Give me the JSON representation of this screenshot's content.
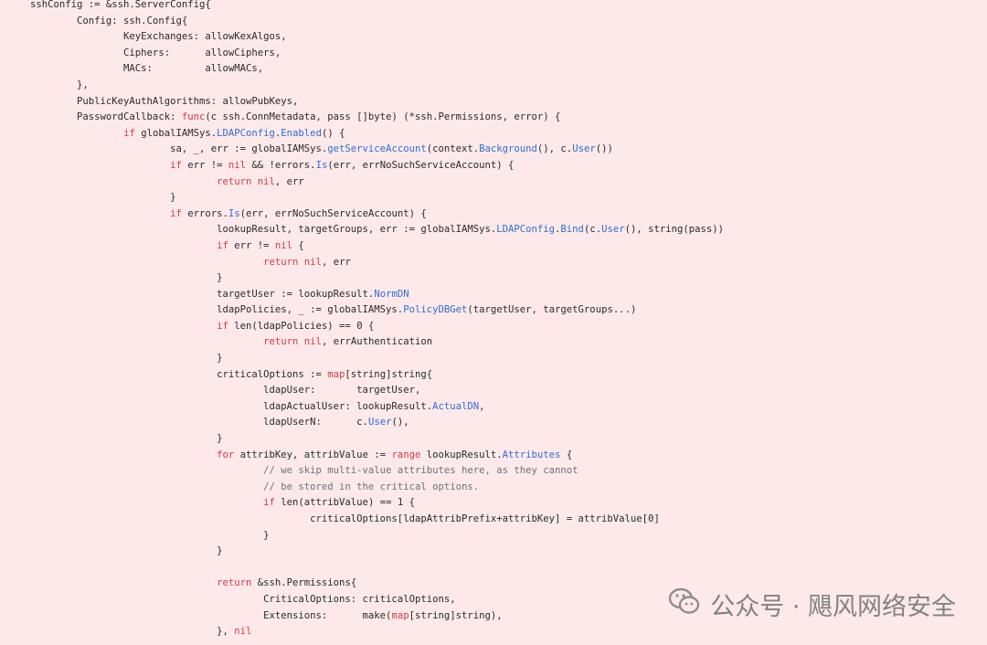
{
  "code": {
    "lines": [
      [
        [
          "sshConfig := &ssh.ServerConfig{",
          ""
        ]
      ],
      [
        [
          "\tConfig: ssh.Config{",
          ""
        ]
      ],
      [
        [
          "\t\tKeyExchanges: allowKexAlgos,",
          ""
        ]
      ],
      [
        [
          "\t\tCiphers:      allowCiphers,",
          ""
        ]
      ],
      [
        [
          "\t\tMACs:         allowMACs,",
          ""
        ]
      ],
      [
        [
          "\t},",
          ""
        ]
      ],
      [
        [
          "\tPublicKeyAuthAlgorithms: allowPubKeys,",
          ""
        ]
      ],
      [
        [
          "\tPasswordCallback: ",
          ""
        ],
        [
          "func",
          "kw"
        ],
        [
          "(c ssh.ConnMetadata, pass []byte) (*ssh.Permissions, error) {",
          ""
        ]
      ],
      [
        [
          "\t\t",
          ""
        ],
        [
          "if",
          "kw"
        ],
        [
          " globalIAMSys.",
          ""
        ],
        [
          "LDAPConfig",
          "fn"
        ],
        [
          ".",
          ""
        ],
        [
          "Enabled",
          "fn"
        ],
        [
          "() {",
          ""
        ]
      ],
      [
        [
          "\t\t\tsa, _, err := globalIAMSys.",
          ""
        ],
        [
          "getServiceAccount",
          "fn"
        ],
        [
          "(context.",
          ""
        ],
        [
          "Background",
          "fn"
        ],
        [
          "(), c.",
          ""
        ],
        [
          "User",
          "fn"
        ],
        [
          "())",
          ""
        ]
      ],
      [
        [
          "\t\t\t",
          ""
        ],
        [
          "if",
          "kw"
        ],
        [
          " err != ",
          ""
        ],
        [
          "nil",
          "kw"
        ],
        [
          " && !errors.",
          ""
        ],
        [
          "Is",
          "fn"
        ],
        [
          "(err, errNoSuchServiceAccount) {",
          ""
        ]
      ],
      [
        [
          "\t\t\t\t",
          ""
        ],
        [
          "return",
          "kw"
        ],
        [
          " ",
          ""
        ],
        [
          "nil",
          "kw"
        ],
        [
          ", err",
          ""
        ]
      ],
      [
        [
          "\t\t\t}",
          ""
        ]
      ],
      [
        [
          "\t\t\t",
          ""
        ],
        [
          "if",
          "kw"
        ],
        [
          " errors.",
          ""
        ],
        [
          "Is",
          "fn"
        ],
        [
          "(err, errNoSuchServiceAccount) {",
          ""
        ]
      ],
      [
        [
          "\t\t\t\tlookupResult, targetGroups, err := globalIAMSys.",
          ""
        ],
        [
          "LDAPConfig",
          "fn"
        ],
        [
          ".",
          ""
        ],
        [
          "Bind",
          "fn"
        ],
        [
          "(c.",
          ""
        ],
        [
          "User",
          "fn"
        ],
        [
          "(), string(pass))",
          ""
        ]
      ],
      [
        [
          "\t\t\t\t",
          ""
        ],
        [
          "if",
          "kw"
        ],
        [
          " err != ",
          ""
        ],
        [
          "nil",
          "kw"
        ],
        [
          " {",
          ""
        ]
      ],
      [
        [
          "\t\t\t\t\t",
          ""
        ],
        [
          "return",
          "kw"
        ],
        [
          " ",
          ""
        ],
        [
          "nil",
          "kw"
        ],
        [
          ", err",
          ""
        ]
      ],
      [
        [
          "\t\t\t\t}",
          ""
        ]
      ],
      [
        [
          "\t\t\t\ttargetUser := lookupResult.",
          ""
        ],
        [
          "NormDN",
          "fn"
        ]
      ],
      [
        [
          "\t\t\t\tldapPolicies, _ := globalIAMSys.",
          ""
        ],
        [
          "PolicyDBGet",
          "fn"
        ],
        [
          "(targetUser, targetGroups...)",
          ""
        ]
      ],
      [
        [
          "\t\t\t\t",
          ""
        ],
        [
          "if",
          "kw"
        ],
        [
          " len(ldapPolicies) == 0 {",
          ""
        ]
      ],
      [
        [
          "\t\t\t\t\t",
          ""
        ],
        [
          "return",
          "kw"
        ],
        [
          " ",
          ""
        ],
        [
          "nil",
          "kw"
        ],
        [
          ", errAuthentication",
          ""
        ]
      ],
      [
        [
          "\t\t\t\t}",
          ""
        ]
      ],
      [
        [
          "\t\t\t\tcriticalOptions := ",
          ""
        ],
        [
          "map",
          "kw"
        ],
        [
          "[string]string{",
          ""
        ]
      ],
      [
        [
          "\t\t\t\t\tldapUser:       targetUser,",
          ""
        ]
      ],
      [
        [
          "\t\t\t\t\tldapActualUser: lookupResult.",
          ""
        ],
        [
          "ActualDN",
          "fn"
        ],
        [
          ",",
          ""
        ]
      ],
      [
        [
          "\t\t\t\t\tldapUserN:      c.",
          ""
        ],
        [
          "User",
          "fn"
        ],
        [
          "(),",
          ""
        ]
      ],
      [
        [
          "\t\t\t\t}",
          ""
        ]
      ],
      [
        [
          "\t\t\t\t",
          ""
        ],
        [
          "for",
          "kw"
        ],
        [
          " attribKey, attribValue := ",
          ""
        ],
        [
          "range",
          "kw"
        ],
        [
          " lookupResult.",
          ""
        ],
        [
          "Attributes",
          "fn"
        ],
        [
          " {",
          ""
        ]
      ],
      [
        [
          "\t\t\t\t\t",
          ""
        ],
        [
          "// we skip multi-value attributes here, as they cannot",
          "cm"
        ]
      ],
      [
        [
          "\t\t\t\t\t",
          ""
        ],
        [
          "// be stored in the critical options.",
          "cm"
        ]
      ],
      [
        [
          "\t\t\t\t\t",
          ""
        ],
        [
          "if",
          "kw"
        ],
        [
          " len(attribValue) == 1 {",
          ""
        ]
      ],
      [
        [
          "\t\t\t\t\t\tcriticalOptions[ldapAttribPrefix+attribKey] = attribValue[0]",
          ""
        ]
      ],
      [
        [
          "\t\t\t\t\t}",
          ""
        ]
      ],
      [
        [
          "\t\t\t\t}",
          ""
        ]
      ],
      [
        [
          "",
          ""
        ]
      ],
      [
        [
          "\t\t\t\t",
          ""
        ],
        [
          "return",
          "kw"
        ],
        [
          " &ssh.Permissions{",
          ""
        ]
      ],
      [
        [
          "\t\t\t\t\tCriticalOptions: criticalOptions,",
          ""
        ]
      ],
      [
        [
          "\t\t\t\t\tExtensions:      make(",
          ""
        ],
        [
          "map",
          "kw"
        ],
        [
          "[string]string),",
          ""
        ]
      ],
      [
        [
          "\t\t\t\t}, ",
          ""
        ],
        [
          "nil",
          "kw"
        ]
      ]
    ]
  },
  "watermark": {
    "label": "公众号 · 飓风网络安全",
    "icon": "wechat-icon"
  }
}
